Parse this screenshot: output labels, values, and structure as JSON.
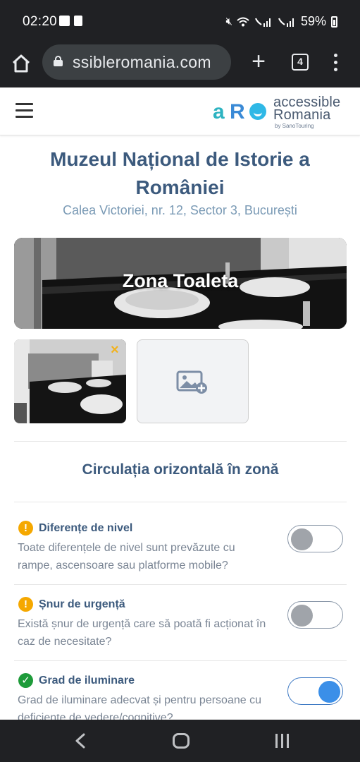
{
  "status_bar": {
    "time": "02:20",
    "battery": "59%",
    "icons": [
      "gallery-icon",
      "device-icon",
      "mute-icon",
      "wifi-icon",
      "call-sim1-icon",
      "signal1-icon",
      "call-sim2-icon",
      "signal2-icon",
      "battery-icon"
    ]
  },
  "browser": {
    "url": "ssibleromania.com",
    "tab_count": "4",
    "new_tab_symbol": "+"
  },
  "site": {
    "logo": {
      "mark_a": "a",
      "mark_r": "R",
      "line1": "accessible",
      "line2": "Romania",
      "line3": "by SanoTouring"
    }
  },
  "page": {
    "title": "Muzeul Național de Istorie a României",
    "address": "Calea Victoriei, nr. 12, Sector 3, București",
    "zone_label": "Zona Toaleta",
    "thumb_close": "×",
    "section_title": "Circulația orizontală în zonă"
  },
  "questions": [
    {
      "status": "warning",
      "status_symbol": "!",
      "label": "Diferențe de nivel",
      "description": "Toate diferențele de nivel sunt prevăzute cu rampe, ascensoare sau platforme mobile?",
      "toggle_on": false
    },
    {
      "status": "warning",
      "status_symbol": "!",
      "label": "Șnur de urgență",
      "description": "Există șnur de urgență care să poată fi acționat în caz de necesitate?",
      "toggle_on": false
    },
    {
      "status": "ok",
      "status_symbol": "✓",
      "label": "Grad de iluminare",
      "description": "Grad de iluminare adecvat și pentru persoane cu deficiențe de vedere/cognitive?",
      "toggle_on": true
    }
  ],
  "colors": {
    "heading": "#3c5a7d",
    "subheading": "#7a9ab5",
    "warning": "#f5a800",
    "ok": "#1e9b3a",
    "toggle_on": "#3b8fe8"
  }
}
